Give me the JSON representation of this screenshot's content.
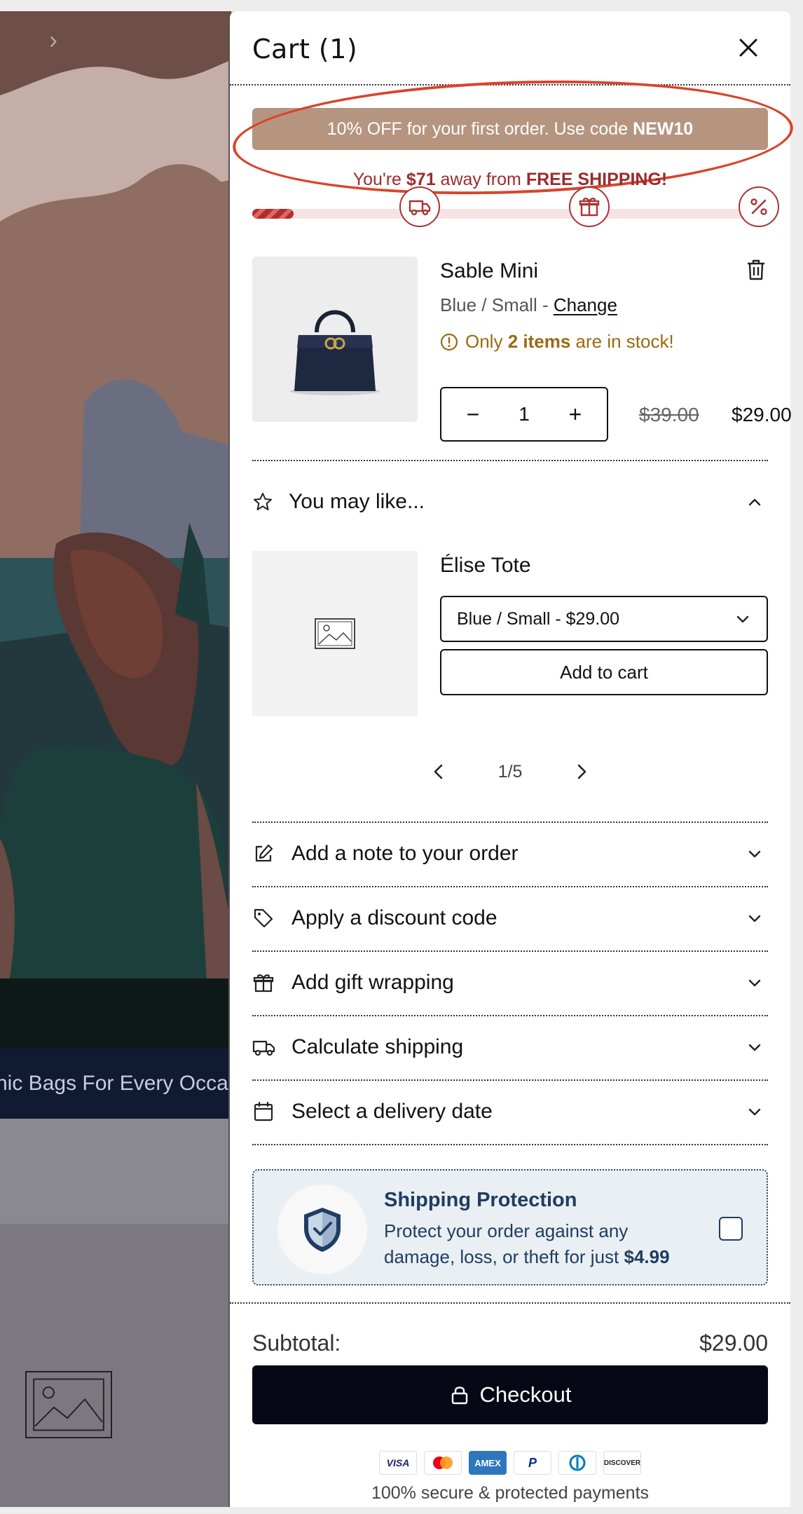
{
  "background": {
    "banner_text": "hic Bags For Every Occa"
  },
  "cart": {
    "title": "Cart (1)",
    "promo": {
      "text": "10% OFF for your first order. Use code ",
      "code": "NEW10"
    },
    "shipping_message": {
      "prefix": "You're ",
      "amount": "$71",
      "middle": " away from ",
      "goal": "FREE SHIPPING!"
    },
    "progress": {
      "fraction": 0.08,
      "milestones": [
        "truck-icon",
        "gift-icon",
        "percent-icon"
      ]
    },
    "item": {
      "title": "Sable Mini",
      "variant": "Blue / Small - ",
      "change_label": "Change",
      "stock_prefix": "Only ",
      "stock_count": "2 items",
      "stock_suffix": " are in stock!",
      "quantity": "1",
      "price_original": "$39.00",
      "price_sale": "$29.00"
    },
    "recommendations": {
      "heading": "You may like...",
      "product_title": "Élise Tote",
      "selected_option": "Blue / Small - $29.00",
      "add_label": "Add to cart",
      "pager": "1/5"
    },
    "accordions": [
      {
        "label": "Add a note to your order",
        "icon": "edit-icon"
      },
      {
        "label": "Apply a discount code",
        "icon": "tag-icon"
      },
      {
        "label": "Add gift wrapping",
        "icon": "gift-icon"
      },
      {
        "label": "Calculate shipping",
        "icon": "truck-icon"
      },
      {
        "label": "Select a delivery date",
        "icon": "calendar-icon"
      }
    ],
    "shipping_protection": {
      "title": "Shipping Protection",
      "desc": "Protect your order against any damage, loss, or theft for just ",
      "price": "$4.99"
    },
    "subtotal_label": "Subtotal:",
    "subtotal_value": "$29.00",
    "checkout_label": "Checkout",
    "payment_methods": [
      "VISA",
      "Mastercard",
      "AMEX",
      "PayPal",
      "Diners",
      "DISCOVER"
    ],
    "secure_text": "100% secure & protected payments"
  },
  "colors": {
    "promo": "#b59580",
    "progress": "#b22d2d",
    "stock": "#9a6a12",
    "protection": "#1f3d63",
    "checkout": "#060915"
  }
}
